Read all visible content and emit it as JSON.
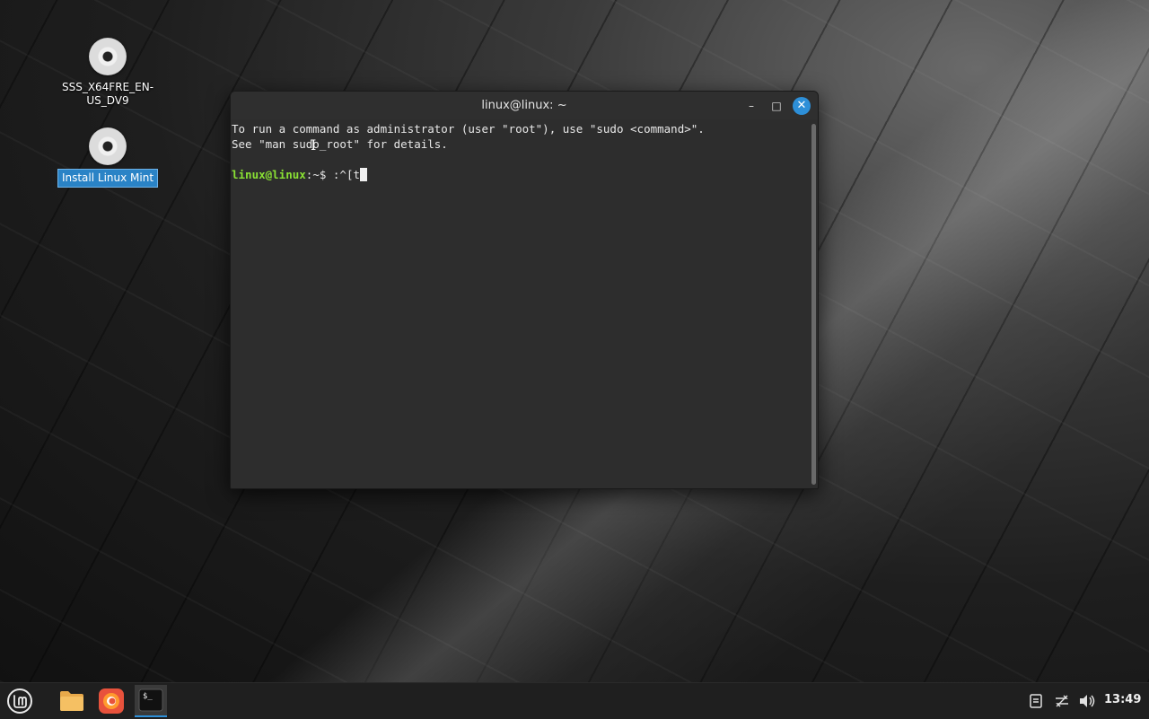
{
  "desktop": {
    "icons": [
      {
        "label": "SSS_X64FRE_EN-US_DV9",
        "icon": "disc-icon",
        "selected": false
      },
      {
        "label": "Install Linux Mint",
        "icon": "disc-icon",
        "selected": true
      }
    ]
  },
  "terminal": {
    "title": "linux@linux: ~",
    "lines": [
      "To run a command as administrator (user \"root\"), use \"sudo <command>\".",
      "See \"man sudo_root\" for details."
    ],
    "prompt_user": "linux@linux",
    "prompt_rest": ":~$ ",
    "input": ":^[t",
    "buttons": {
      "minimize": "–",
      "maximize": "□",
      "close": "✕"
    }
  },
  "taskbar": {
    "items": [
      {
        "name": "menu-button",
        "icon": "linux-mint-logo-icon"
      },
      {
        "name": "files",
        "icon": "folder-icon"
      },
      {
        "name": "firefox",
        "icon": "firefox-icon"
      },
      {
        "name": "terminal",
        "icon": "terminal-icon",
        "active": true
      }
    ],
    "tray": [
      "notes-icon",
      "network-icon",
      "volume-icon"
    ],
    "clock": "13:49"
  },
  "colors": {
    "accent": "#2d8fd8",
    "prompt_green": "#8ae234",
    "terminal_bg": "#2d2d2d"
  }
}
